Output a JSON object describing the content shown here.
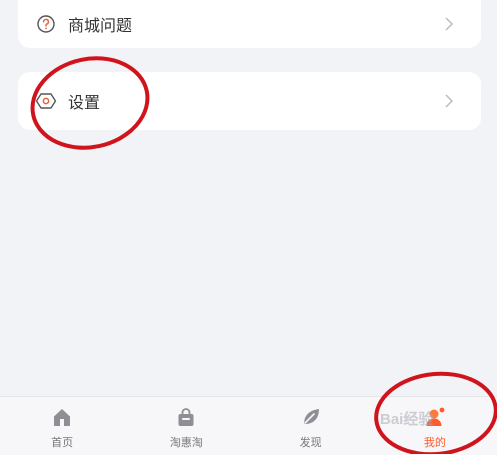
{
  "menu": {
    "items": [
      {
        "label": "商城问题",
        "icon": "question-circle-icon"
      },
      {
        "label": "设置",
        "icon": "settings-hexagon-icon"
      }
    ]
  },
  "tabbar": {
    "tabs": [
      {
        "label": "首页",
        "icon": "home-icon"
      },
      {
        "label": "淘惠淘",
        "icon": "shopping-bag-icon"
      },
      {
        "label": "发现",
        "icon": "leaf-icon"
      },
      {
        "label": "我的",
        "icon": "profile-icon",
        "active": true
      }
    ]
  },
  "watermark": {
    "text": "Bai经验"
  },
  "colors": {
    "accent": "#ff5a2a",
    "annotation": "#d0141c",
    "question_icon": "#e8623a"
  }
}
